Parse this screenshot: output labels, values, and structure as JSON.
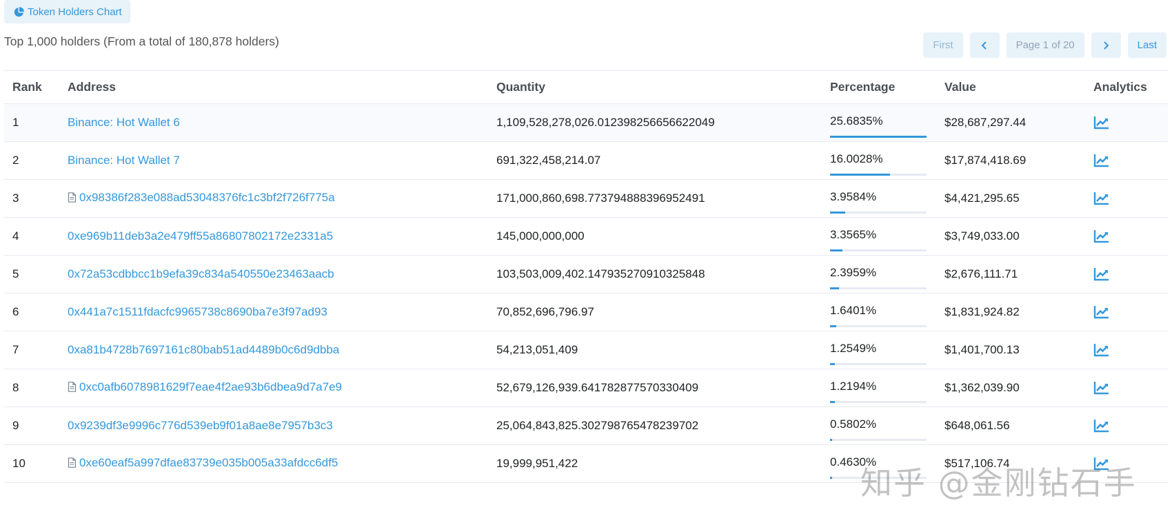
{
  "chart_button": {
    "label": "Token Holders Chart",
    "icon": "pie-chart-icon"
  },
  "summary": "Top 1,000 holders (From a total of 180,878 holders)",
  "pager": {
    "first": "First",
    "page_info": "Page 1 of 20",
    "last": "Last"
  },
  "columns": {
    "rank": "Rank",
    "address": "Address",
    "quantity": "Quantity",
    "percentage": "Percentage",
    "value": "Value",
    "analytics": "Analytics"
  },
  "accent_color": "#3498db",
  "rows": [
    {
      "rank": "1",
      "address": "Binance: Hot Wallet 6",
      "contract": false,
      "quantity": "1,109,528,278,026.012398256656622049",
      "percentage": "25.6835%",
      "pct_value": 25.6835,
      "value": "$28,687,297.44"
    },
    {
      "rank": "2",
      "address": "Binance: Hot Wallet 7",
      "contract": false,
      "quantity": "691,322,458,214.07",
      "percentage": "16.0028%",
      "pct_value": 16.0028,
      "value": "$17,874,418.69"
    },
    {
      "rank": "3",
      "address": "0x98386f283e088ad53048376fc1c3bf2f726f775a",
      "contract": true,
      "quantity": "171,000,860,698.773794888396952491",
      "percentage": "3.9584%",
      "pct_value": 3.9584,
      "value": "$4,421,295.65"
    },
    {
      "rank": "4",
      "address": "0xe969b11deb3a2e479ff55a86807802172e2331a5",
      "contract": false,
      "quantity": "145,000,000,000",
      "percentage": "3.3565%",
      "pct_value": 3.3565,
      "value": "$3,749,033.00"
    },
    {
      "rank": "5",
      "address": "0x72a53cdbbcc1b9efa39c834a540550e23463aacb",
      "contract": false,
      "quantity": "103,503,009,402.147935270910325848",
      "percentage": "2.3959%",
      "pct_value": 2.3959,
      "value": "$2,676,111.71"
    },
    {
      "rank": "6",
      "address": "0x441a7c1511fdacfc9965738c8690ba7e3f97ad93",
      "contract": false,
      "quantity": "70,852,696,796.97",
      "percentage": "1.6401%",
      "pct_value": 1.6401,
      "value": "$1,831,924.82"
    },
    {
      "rank": "7",
      "address": "0xa81b4728b7697161c80bab51ad4489b0c6d9dbba",
      "contract": false,
      "quantity": "54,213,051,409",
      "percentage": "1.2549%",
      "pct_value": 1.2549,
      "value": "$1,401,700.13"
    },
    {
      "rank": "8",
      "address": "0xc0afb6078981629f7eae4f2ae93b6dbea9d7a7e9",
      "contract": true,
      "quantity": "52,679,126,939.641782877570330409",
      "percentage": "1.2194%",
      "pct_value": 1.2194,
      "value": "$1,362,039.90"
    },
    {
      "rank": "9",
      "address": "0x9239df3e9996c776d539eb9f01a8ae8e7957b3c3",
      "contract": false,
      "quantity": "25,064,843,825.302798765478239702",
      "percentage": "0.5802%",
      "pct_value": 0.5802,
      "value": "$648,061.56"
    },
    {
      "rank": "10",
      "address": "0xe60eaf5a997dfae83739e035b005a33afdcc6df5",
      "contract": true,
      "quantity": "19,999,951,422",
      "percentage": "0.4630%",
      "pct_value": 0.463,
      "value": "$517,106.74"
    }
  ],
  "watermark": "知乎 @金刚钻石手"
}
